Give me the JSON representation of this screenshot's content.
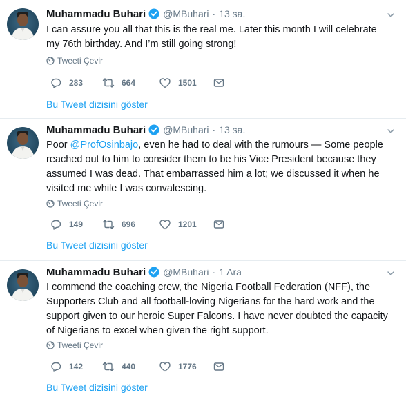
{
  "colors": {
    "link": "#1da1f2",
    "secondary_text": "#657786",
    "primary_text": "#14171a",
    "divider": "#e6ecf0",
    "verified_badge": "#1da1f2"
  },
  "icons": {
    "verified": "verified-badge-icon",
    "caret": "chevron-down-icon",
    "translate": "globe-icon",
    "reply": "reply-bubble-icon",
    "retweet": "retweet-icon",
    "like": "heart-icon",
    "dm": "envelope-icon"
  },
  "tweets": [
    {
      "author_name": "Muhammadu Buhari",
      "handle": "@MBuhari",
      "separator": "·",
      "time": "13 sa.",
      "text": "I can assure you all that this is the real me. Later this month I will celebrate my 76th birthday. And I’m still going strong!",
      "translate_label": "Tweeti Çevir",
      "replies": "283",
      "retweets": "664",
      "likes": "1501",
      "thread_link": "Bu Tweet dizisini göster"
    },
    {
      "author_name": "Muhammadu Buhari",
      "handle": "@MBuhari",
      "separator": "·",
      "time": "13 sa.",
      "text_before": "Poor ",
      "mention": "@ProfOsinbajo",
      "text_after": ", even he had to deal with the rumours — Some people reached out to him to consider them to be his Vice President because they assumed I was dead. That embarrassed him a lot; we discussed it when he visited me while I was convalescing.",
      "translate_label": "Tweeti Çevir",
      "replies": "149",
      "retweets": "696",
      "likes": "1201",
      "thread_link": "Bu Tweet dizisini göster"
    },
    {
      "author_name": "Muhammadu Buhari",
      "handle": "@MBuhari",
      "separator": "·",
      "time": "1 Ara",
      "text": "I commend the coaching crew, the Nigeria Football Federation (NFF), the Supporters Club and all football-loving Nigerians for the hard work and the support given to our heroic Super Falcons. I have never doubted the capacity of Nigerians to excel when given the right support.",
      "translate_label": "Tweeti Çevir",
      "replies": "142",
      "retweets": "440",
      "likes": "1776",
      "thread_link": "Bu Tweet dizisini göster"
    }
  ]
}
